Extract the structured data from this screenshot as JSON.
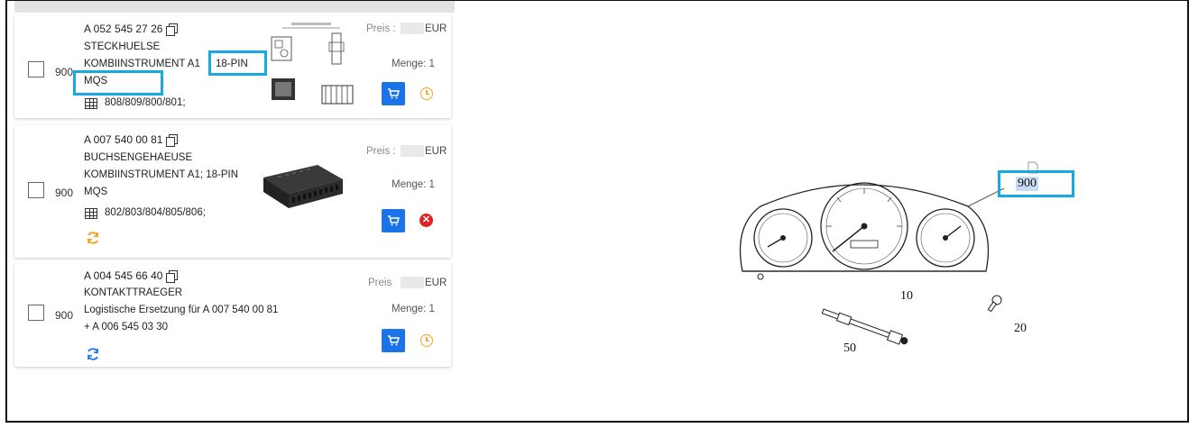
{
  "items": [
    {
      "position": "900",
      "part_number": "A 052 545 27 26",
      "name": "STECKHUELSE",
      "line1_a": "KOMBIINSTRUMENT A1",
      "line1_b": "18-PIN",
      "line2": "MQS",
      "models": "808/809/800/801;",
      "preis_label": "Preis :",
      "currency": "EUR",
      "menge": "Menge: 1",
      "status_icon": "clock-icon"
    },
    {
      "position": "900",
      "part_number": "A 007 540 00 81",
      "name": "BUCHSENGEHAEUSE",
      "line1": "KOMBIINSTRUMENT A1; 18-PIN",
      "line2": "MQS",
      "models": "802/803/804/805/806;",
      "preis_label": "Preis :",
      "currency": "EUR",
      "menge": "Menge: 1",
      "status_icon": "x-icon",
      "extra_icon": "refresh-icon"
    },
    {
      "position": "900",
      "part_number": "A 004 545 66 40",
      "name": "KONTAKTTRAEGER",
      "line1": "Logistische Ersetzung für A 007 540 00 81",
      "line2": "+ A 006 545 03 30",
      "preis_label": "Preis",
      "currency": "EUR",
      "menge": "Menge: 1",
      "status_icon": "clock-icon",
      "extra_icon": "refresh-icon"
    }
  ],
  "diagram": {
    "callouts": [
      "900",
      "10",
      "20",
      "50"
    ]
  },
  "colors": {
    "accent": "#1a73e8",
    "highlight": "#17a9e0",
    "warning": "#f5a623",
    "danger": "#e02424"
  }
}
